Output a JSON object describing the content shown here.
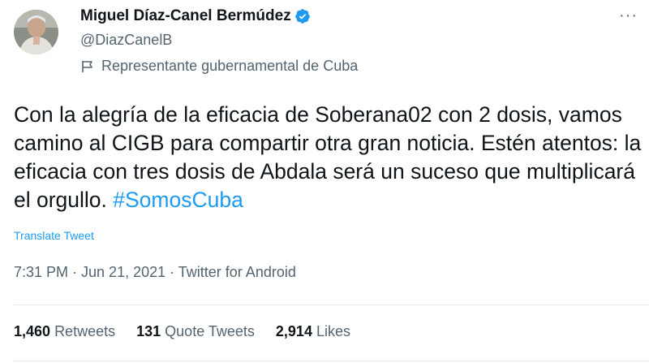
{
  "author": {
    "name": "Miguel Díaz-Canel Bermúdez",
    "handle": "@DiazCanelB",
    "label": "Representante gubernamental de Cuba",
    "verified_color": "#1d9bf0"
  },
  "tweet": {
    "text": "Con la alegría de la eficacia de Soberana02 con 2 dosis, vamos camino al CIGB para compartir otra gran noticia. Estén atentos: la eficacia con tres dosis de Abdala será un suceso que multiplicará el orgullo. ",
    "hashtag": "#SomosCuba",
    "translate": "Translate Tweet",
    "timestamp": "7:31 PM · Jun 21, 2021 · Twitter for Android"
  },
  "stats": {
    "retweets_count": "1,460",
    "retweets_label": "Retweets",
    "quotes_count": "131",
    "quotes_label": "Quote Tweets",
    "likes_count": "2,914",
    "likes_label": "Likes"
  },
  "icons": {
    "more": "more-options-icon",
    "verified": "verified-badge-icon",
    "label": "flag-icon"
  }
}
